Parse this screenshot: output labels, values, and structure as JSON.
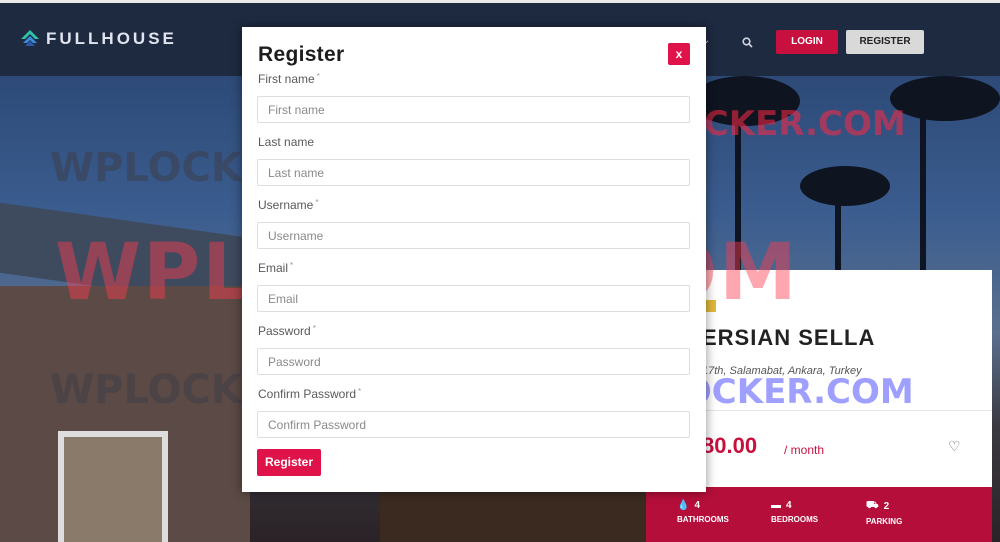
{
  "brand": {
    "name": "FULLHOUSE"
  },
  "header": {
    "login_label": "LOGIN",
    "register_label": "REGISTER"
  },
  "property": {
    "title": "ERSIAN SELLA",
    "address": "17th, Salamabat, Ankara, Turkey",
    "price": "80.00",
    "price_unit": "/ month",
    "stats": [
      {
        "value": "4",
        "label": "BATHROOMS",
        "icon": "drop-icon"
      },
      {
        "value": "4",
        "label": "BEDROOMS",
        "icon": "bed-icon"
      },
      {
        "value": "2",
        "label": "PARKING",
        "icon": "car-icon"
      }
    ]
  },
  "watermark": {
    "text": "WPLOCKER.COM"
  },
  "modal": {
    "title": "Register",
    "close_label": "x",
    "fields": [
      {
        "label": "First name",
        "placeholder": "First name",
        "required": "*"
      },
      {
        "label": "Last name",
        "placeholder": "Last name",
        "required": ""
      },
      {
        "label": "Username",
        "placeholder": "Username",
        "required": "*"
      },
      {
        "label": "Email",
        "placeholder": "Email",
        "required": "*"
      },
      {
        "label": "Password",
        "placeholder": "Password",
        "required": "*"
      },
      {
        "label": "Confirm Password",
        "placeholder": "Confirm Password",
        "required": "*"
      }
    ],
    "submit_label": "Register"
  },
  "colors": {
    "accent": "#e0124a",
    "header_bg": "#1e2a40",
    "card_footer": "#b50e3a"
  }
}
